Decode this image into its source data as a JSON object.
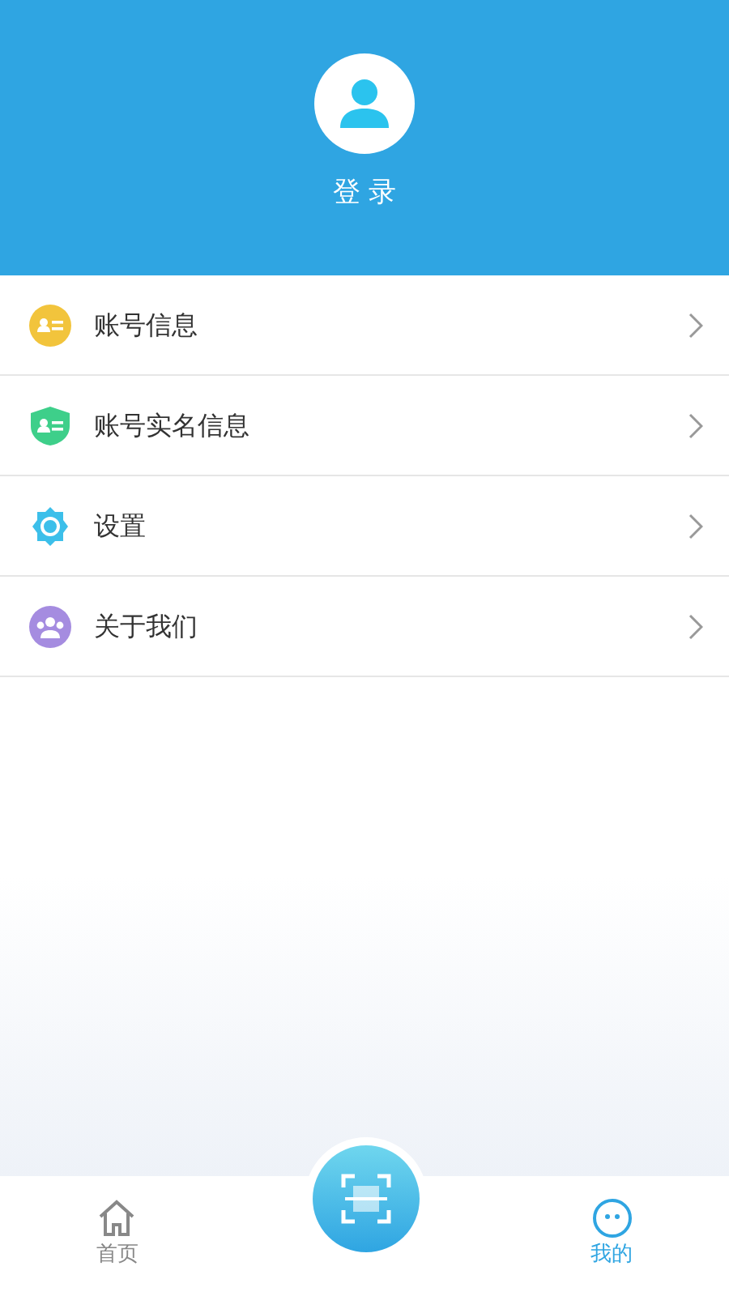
{
  "header": {
    "login_label": "登 录"
  },
  "menu": [
    {
      "label": "账号信息",
      "kind": "id-card",
      "color": "#f2c43c"
    },
    {
      "label": "账号实名信息",
      "kind": "shield",
      "color": "#3ecf8a"
    },
    {
      "label": "设置",
      "kind": "gear",
      "color": "#3cbfea"
    },
    {
      "label": "关于我们",
      "kind": "group",
      "color": "#a58ce0"
    }
  ],
  "tab_bar": [
    {
      "label": "首页",
      "kind": "home",
      "selected": false
    },
    {
      "label": "我的",
      "kind": "face",
      "selected": true
    }
  ]
}
